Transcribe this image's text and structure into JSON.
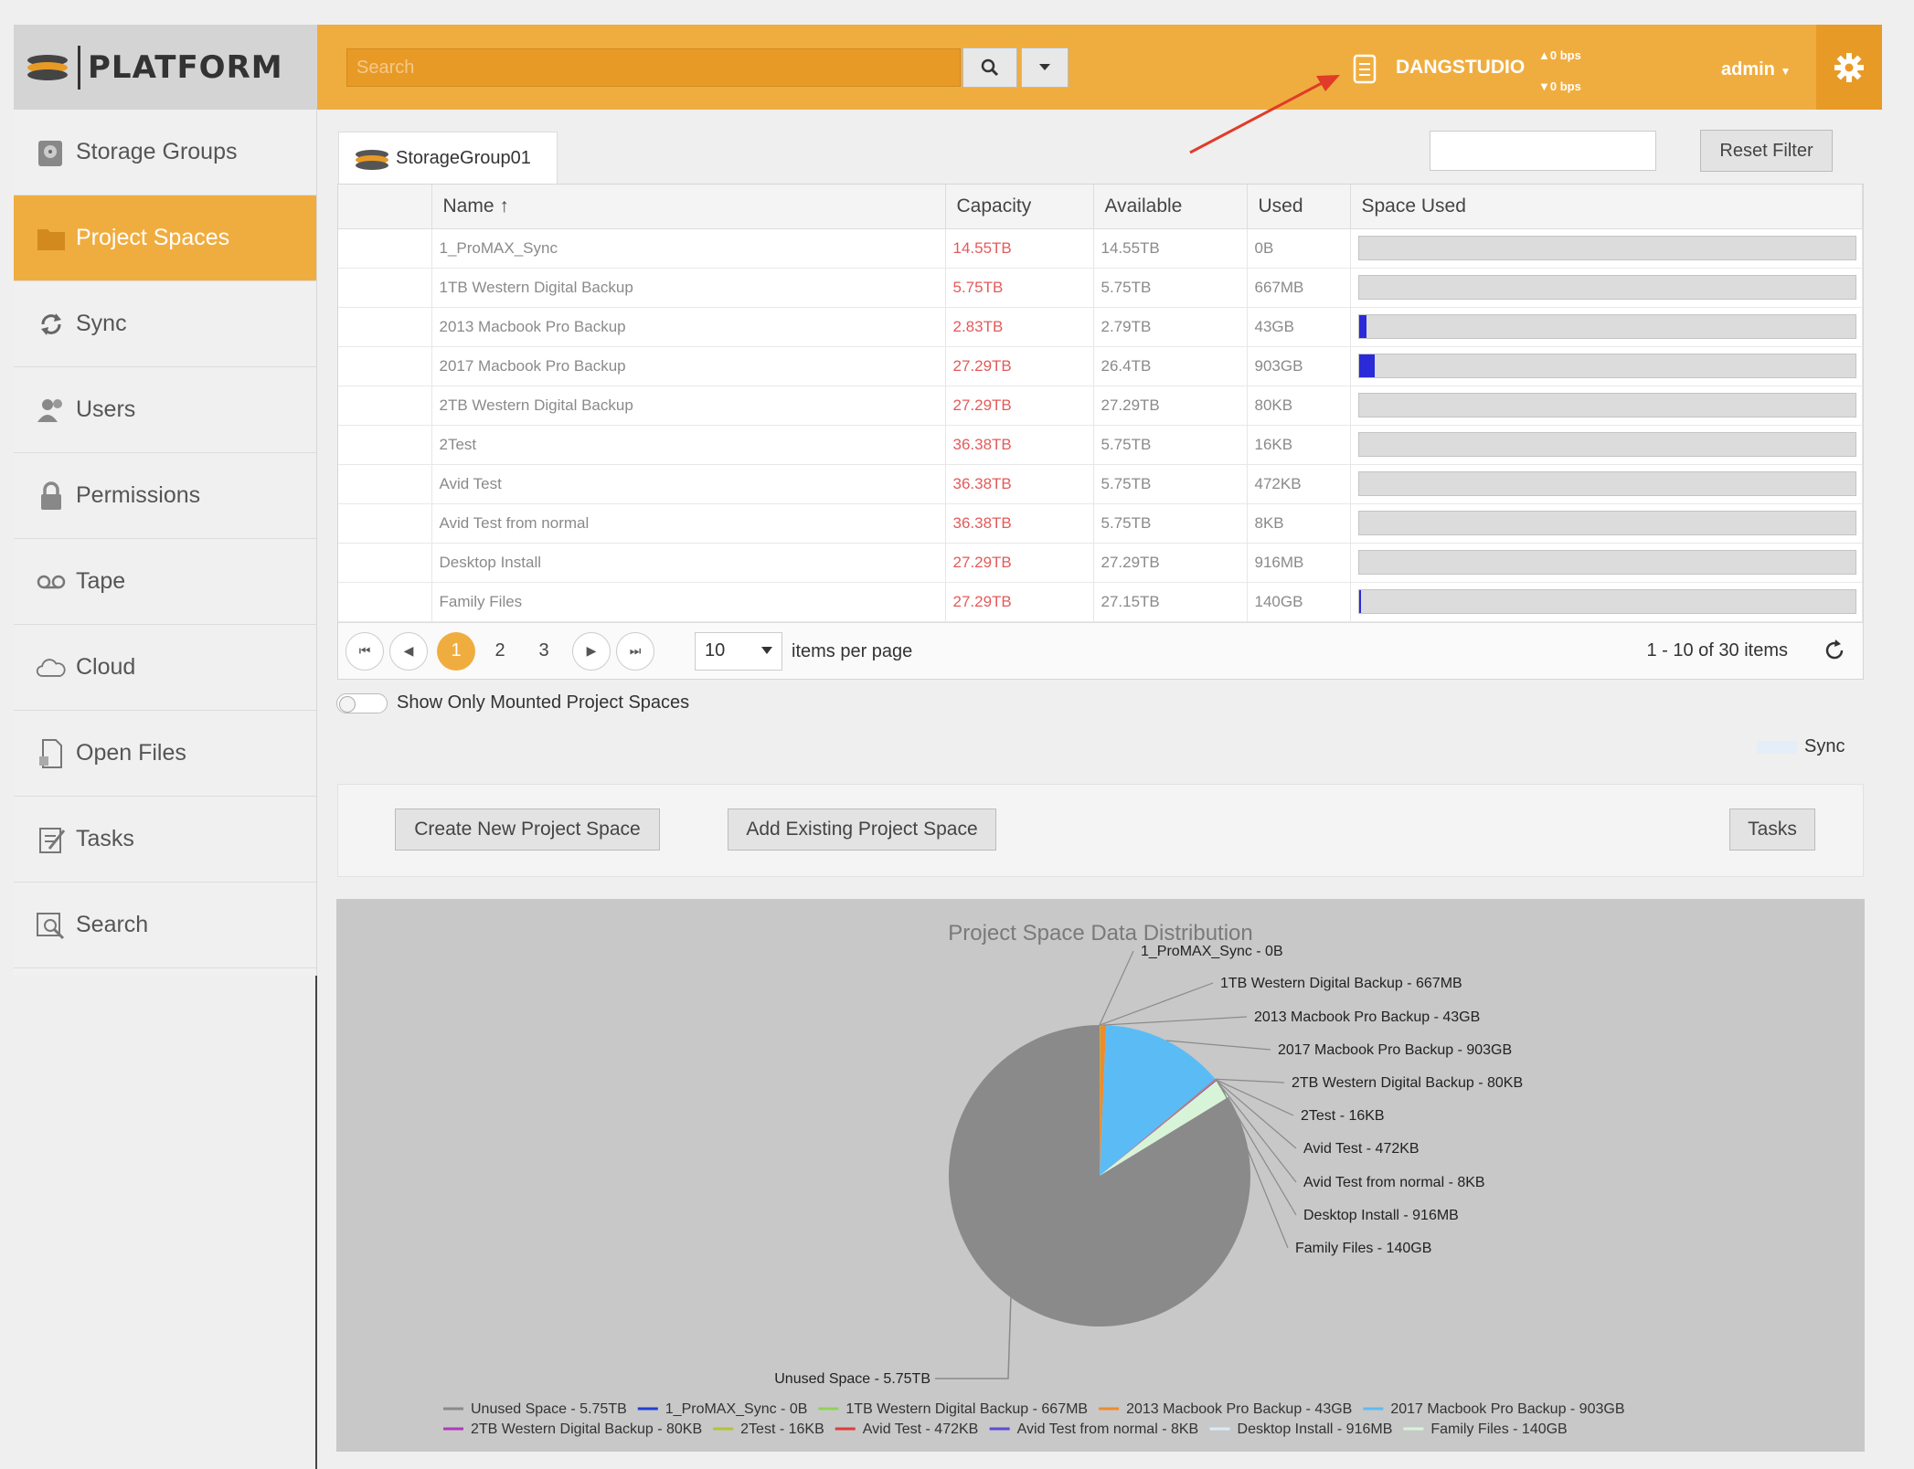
{
  "app": {
    "logo_text": "PLATFORM"
  },
  "topbar": {
    "search_placeholder": "Search",
    "server_name": "DANGSTUDIO",
    "bps_up": "▲0 bps",
    "bps_down": "▼0 bps",
    "user": "admin"
  },
  "sidebar": {
    "items": [
      {
        "label": "Storage Groups",
        "icon": "storage-groups-icon"
      },
      {
        "label": "Project Spaces",
        "icon": "folder-icon",
        "active": true
      },
      {
        "label": "Sync",
        "icon": "sync-icon"
      },
      {
        "label": "Users",
        "icon": "users-icon"
      },
      {
        "label": "Permissions",
        "icon": "lock-icon"
      },
      {
        "label": "Tape",
        "icon": "tape-icon"
      },
      {
        "label": "Cloud",
        "icon": "cloud-icon"
      },
      {
        "label": "Open Files",
        "icon": "open-files-icon"
      },
      {
        "label": "Tasks",
        "icon": "tasks-icon"
      },
      {
        "label": "Search",
        "icon": "search-icon"
      }
    ]
  },
  "tab": {
    "label": "StorageGroup01"
  },
  "filter": {
    "value": "",
    "reset_label": "Reset Filter"
  },
  "table": {
    "headers": {
      "name": "Name ↑",
      "capacity": "Capacity",
      "available": "Available",
      "used": "Used",
      "space_used": "Space Used"
    },
    "rows": [
      {
        "name": "1_ProMAX_Sync",
        "capacity": "14.55TB",
        "available": "14.55TB",
        "used": "0B",
        "pct": 0
      },
      {
        "name": "1TB Western Digital Backup",
        "capacity": "5.75TB",
        "available": "5.75TB",
        "used": "667MB",
        "pct": 0
      },
      {
        "name": "2013 Macbook Pro Backup",
        "capacity": "2.83TB",
        "available": "2.79TB",
        "used": "43GB",
        "pct": 1.5
      },
      {
        "name": "2017 Macbook Pro Backup",
        "capacity": "27.29TB",
        "available": "26.4TB",
        "used": "903GB",
        "pct": 3.3
      },
      {
        "name": "2TB Western Digital Backup",
        "capacity": "27.29TB",
        "available": "27.29TB",
        "used": "80KB",
        "pct": 0
      },
      {
        "name": "2Test",
        "capacity": "36.38TB",
        "available": "5.75TB",
        "used": "16KB",
        "pct": 0
      },
      {
        "name": "Avid Test",
        "capacity": "36.38TB",
        "available": "5.75TB",
        "used": "472KB",
        "pct": 0
      },
      {
        "name": "Avid Test from normal",
        "capacity": "36.38TB",
        "available": "5.75TB",
        "used": "8KB",
        "pct": 0
      },
      {
        "name": "Desktop Install",
        "capacity": "27.29TB",
        "available": "27.29TB",
        "used": "916MB",
        "pct": 0
      },
      {
        "name": "Family Files",
        "capacity": "27.29TB",
        "available": "27.15TB",
        "used": "140GB",
        "pct": 0.5
      }
    ]
  },
  "pager": {
    "pages": [
      "1",
      "2",
      "3"
    ],
    "current": "1",
    "per_page": "10",
    "per_page_label": "items per page",
    "range": "1 - 10 of 30 items"
  },
  "toggle_label": "Show Only Mounted Project Spaces",
  "sync_legend": "Sync",
  "actions": {
    "create": "Create New Project Space",
    "add_existing": "Add Existing Project Space",
    "tasks": "Tasks"
  },
  "chart_data": {
    "type": "pie",
    "title": "Project Space Data Distribution",
    "slices": [
      {
        "name": "Unused Space - 5.75TB",
        "value": 5750,
        "color": "#8a8a8a"
      },
      {
        "name": "1_ProMAX_Sync - 0B",
        "value": 0,
        "color": "#1f3fd6"
      },
      {
        "name": "1TB Western Digital Backup - 667MB",
        "value": 0.667,
        "color": "#8fd35a"
      },
      {
        "name": "2013 Macbook Pro Backup - 43GB",
        "value": 43,
        "color": "#f08a2c"
      },
      {
        "name": "2017 Macbook Pro Backup - 903GB",
        "value": 903,
        "color": "#5bbcf5"
      },
      {
        "name": "2TB Western Digital Backup - 80KB",
        "value": 8e-05,
        "color": "#b03ab8"
      },
      {
        "name": "2Test - 16KB",
        "value": 1.6e-05,
        "color": "#b5c23a"
      },
      {
        "name": "Avid Test - 472KB",
        "value": 0.000472,
        "color": "#e03a3a"
      },
      {
        "name": "Avid Test from normal - 8KB",
        "value": 8e-06,
        "color": "#5a4ad8"
      },
      {
        "name": "Desktop Install - 916MB",
        "value": 0.916,
        "color": "#d8ecf8"
      },
      {
        "name": "Family Files - 140GB",
        "value": 140,
        "color": "#d8f4d8"
      }
    ]
  }
}
